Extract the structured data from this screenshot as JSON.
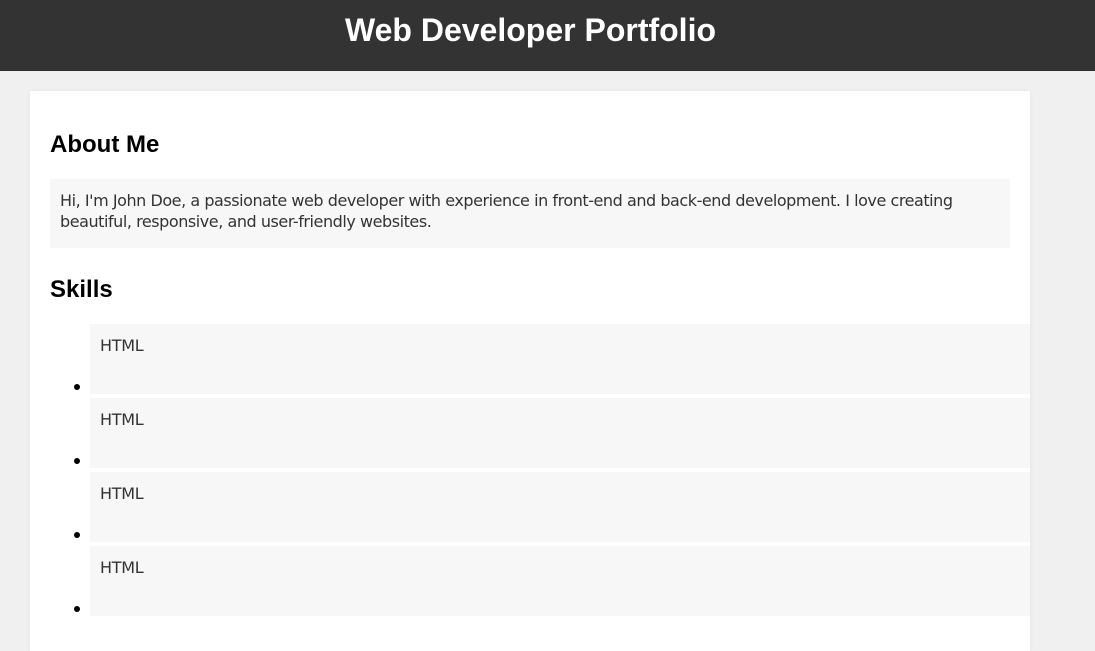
{
  "header": {
    "title": "Web Developer Portfolio",
    "background_color": "#333333"
  },
  "about": {
    "heading": "About Me",
    "text": "Hi, I'm John Doe, a passionate web developer with experience in front-end and back-end development. I love creating beautiful, responsive, and user-friendly websites."
  },
  "skills": {
    "heading": "Skills",
    "items": [
      {
        "label": "HTML"
      },
      {
        "label": "HTML"
      },
      {
        "label": "HTML"
      },
      {
        "label": "HTML"
      }
    ]
  }
}
